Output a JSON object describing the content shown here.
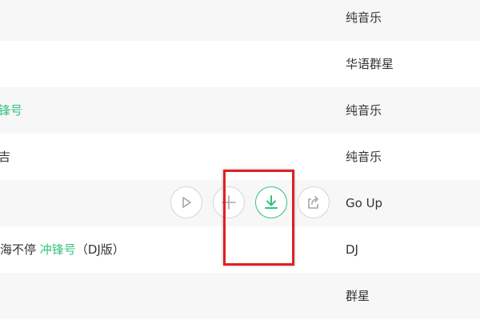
{
  "rows": [
    {
      "title": "",
      "album": "纯音乐"
    },
    {
      "title": "",
      "album": "华语群星"
    },
    {
      "title": "锋号",
      "album": "纯音乐"
    },
    {
      "title": "吉",
      "album": "纯音乐"
    },
    {
      "title": "",
      "album": "Go Up"
    },
    {
      "title_prefix": "海不停",
      "title_highlight": "冲锋号",
      "title_suffix": "（DJ版）",
      "album": "DJ"
    },
    {
      "title": "",
      "album": "群星"
    }
  ],
  "actions": {
    "play": "play-icon",
    "add": "plus-icon",
    "download": "download-icon",
    "share": "share-icon"
  },
  "colors": {
    "accent": "#31c27c",
    "highlight_box": "#e02020",
    "alt_row": "#f7f7f7",
    "text": "#333333"
  }
}
